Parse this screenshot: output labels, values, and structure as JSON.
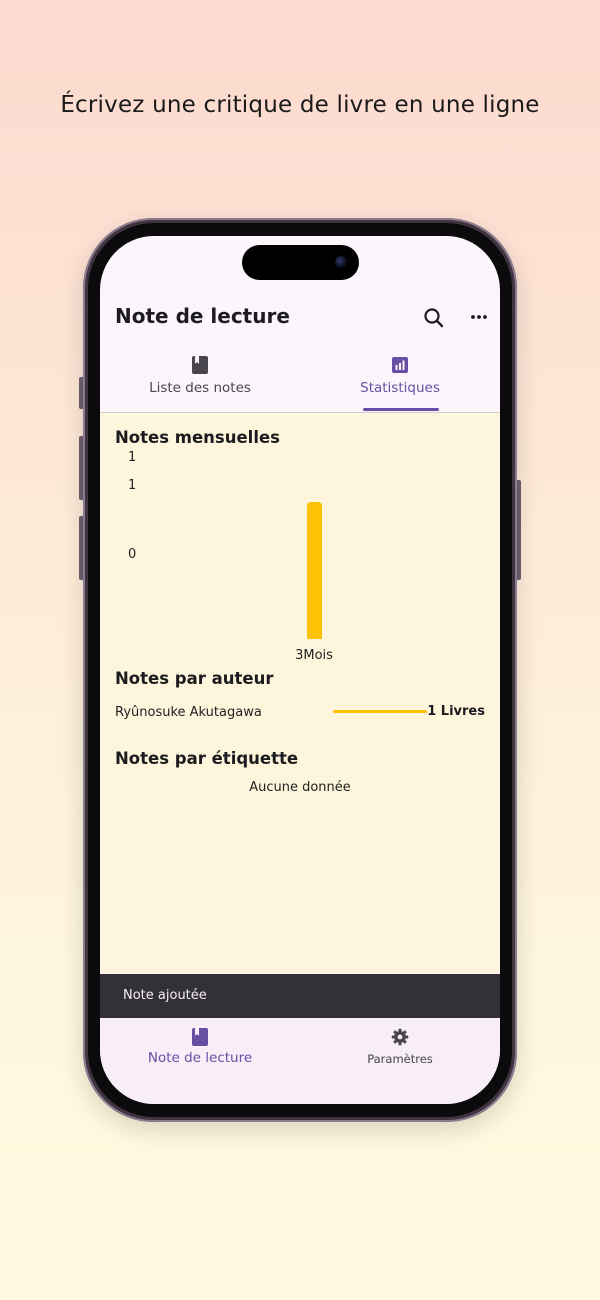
{
  "headline": "Écrivez une critique de livre en une ligne",
  "app": {
    "title": "Note de lecture",
    "actions": [
      {
        "icon": "search-icon"
      },
      {
        "icon": "more-horizontal-icon"
      }
    ]
  },
  "tabs": [
    {
      "label": "Liste des notes",
      "icon": "book-icon",
      "active": false
    },
    {
      "label": "Statistiques",
      "icon": "bar-chart-icon",
      "active": true
    }
  ],
  "sections": {
    "monthly": "Notes mensuelles",
    "author": "Notes par auteur",
    "tag": "Notes par étiquette"
  },
  "chart_data": {
    "type": "bar",
    "categories": [
      "3Mois"
    ],
    "values": [
      1
    ],
    "ytick_labels": [
      "1",
      "1",
      "0"
    ],
    "ylim": [
      0,
      1
    ],
    "color": "#fdc106"
  },
  "author_stats": [
    {
      "name": "Ryûnosuke Akutagawa",
      "count_label": "1 Livres",
      "value": 1
    }
  ],
  "tag_stats": {
    "empty_label": "Aucune donnée"
  },
  "snackbar": {
    "text": "Note ajoutée"
  },
  "bottom_nav": [
    {
      "label": "Note de lecture",
      "icon": "book-icon",
      "active": true
    },
    {
      "label": "Paramètres",
      "icon": "gear-icon",
      "active": false
    }
  ],
  "colors": {
    "accent": "#6750a4",
    "bar": "#fdc106",
    "content_bg": "#fdf6dc",
    "snackbar_bg": "#333136"
  }
}
